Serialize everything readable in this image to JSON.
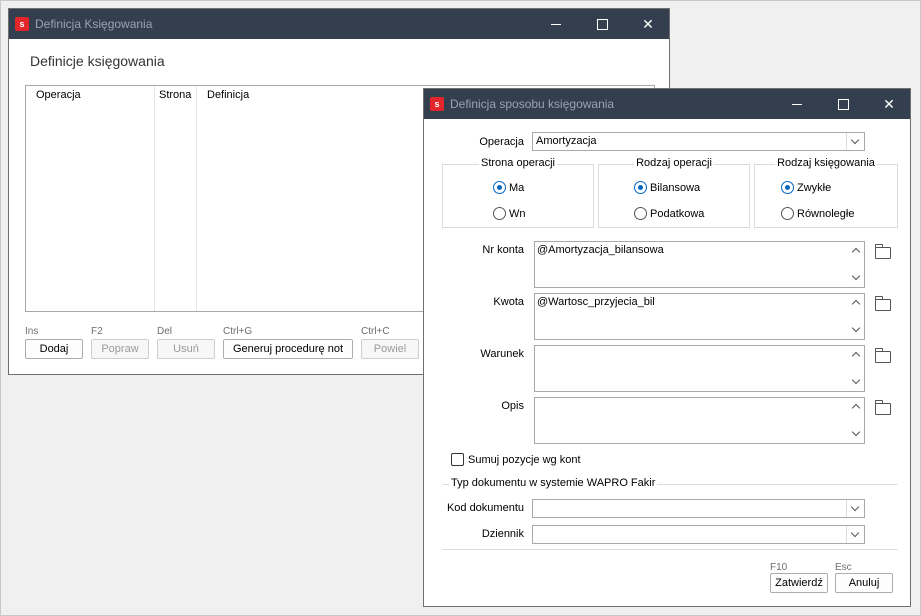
{
  "main_window": {
    "title": "Definicja Księgowania",
    "heading": "Definicje księgowania",
    "columns": [
      "Operacja",
      "Strona",
      "Definicja"
    ],
    "toolbar": [
      {
        "key": "Ins",
        "label": "Dodaj",
        "enabled": true
      },
      {
        "key": "F2",
        "label": "Popraw",
        "enabled": false
      },
      {
        "key": "Del",
        "label": "Usuń",
        "enabled": false
      },
      {
        "key": "Ctrl+G",
        "label": "Generuj procedurę not",
        "enabled": true
      },
      {
        "key": "Ctrl+C",
        "label": "Powiel",
        "enabled": false
      }
    ]
  },
  "dialog": {
    "title": "Definicja sposobu księgowania",
    "operacja": {
      "label": "Operacja",
      "value": "Amortyzacja"
    },
    "strona": {
      "title": "Strona operacji",
      "options": [
        "Ma",
        "Wn"
      ],
      "selected": "Ma"
    },
    "rodzaj_operacji": {
      "title": "Rodzaj operacji",
      "options": [
        "Bilansowa",
        "Podatkowa"
      ],
      "selected": "Bilansowa"
    },
    "rodzaj_ksiegowania": {
      "title": "Rodzaj księgowania",
      "options": [
        "Zwykłe",
        "Równoległe"
      ],
      "selected": "Zwykłe"
    },
    "nr_konta": {
      "label": "Nr konta",
      "value": "@Amortyzacja_bilansowa"
    },
    "kwota": {
      "label": "Kwota",
      "value": "@Wartosc_przyjecia_bil"
    },
    "warunek": {
      "label": "Warunek",
      "value": ""
    },
    "opis": {
      "label": "Opis",
      "value": ""
    },
    "sumuj": {
      "label": "Sumuj pozycje wg kont",
      "checked": false
    },
    "typ_dokumentu": {
      "title": "Typ dokumentu w systemie WAPRO Fakir",
      "kod_dokumentu": {
        "label": "Kod dokumentu",
        "value": ""
      },
      "dziennik": {
        "label": "Dziennik",
        "value": ""
      }
    },
    "buttons": [
      {
        "key": "F10",
        "label": "Zatwierdź"
      },
      {
        "key": "Esc",
        "label": "Anuluj"
      }
    ]
  },
  "colors": {
    "titlebar": "#333f4f",
    "accent": "#0067c0",
    "app_icon": "#e3262c"
  },
  "icons": {
    "app": "s",
    "close": "✕"
  }
}
